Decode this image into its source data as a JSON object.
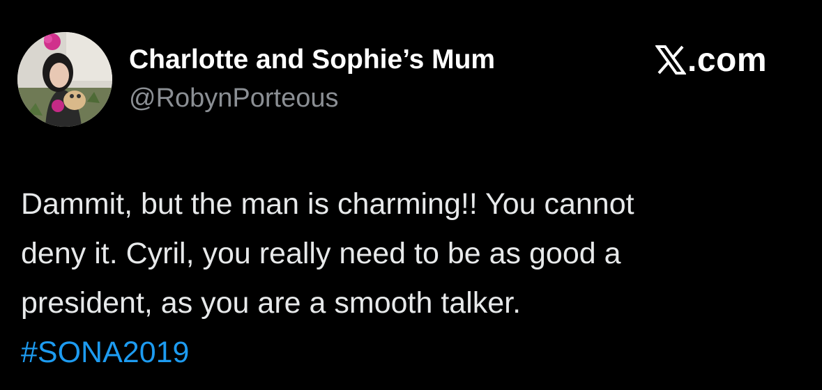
{
  "tweet": {
    "author": {
      "display_name": "Charlotte and Sophie’s Mum",
      "handle": "@RobynPorteous",
      "avatar_icon": "profile-photo-avatar"
    },
    "brand": {
      "icon": "x-logo-icon",
      "text": ".com"
    },
    "body_lines": [
      "Dammit, but the man is charming!! You cannot",
      "deny it. Cyril, you really need to be as good a",
      "president, as you are a smooth talker."
    ],
    "hashtag": "#SONA2019"
  },
  "colors": {
    "background": "#000000",
    "text_primary": "#e7e9ea",
    "text_secondary": "#8b8f94",
    "link": "#1d9bf0"
  }
}
